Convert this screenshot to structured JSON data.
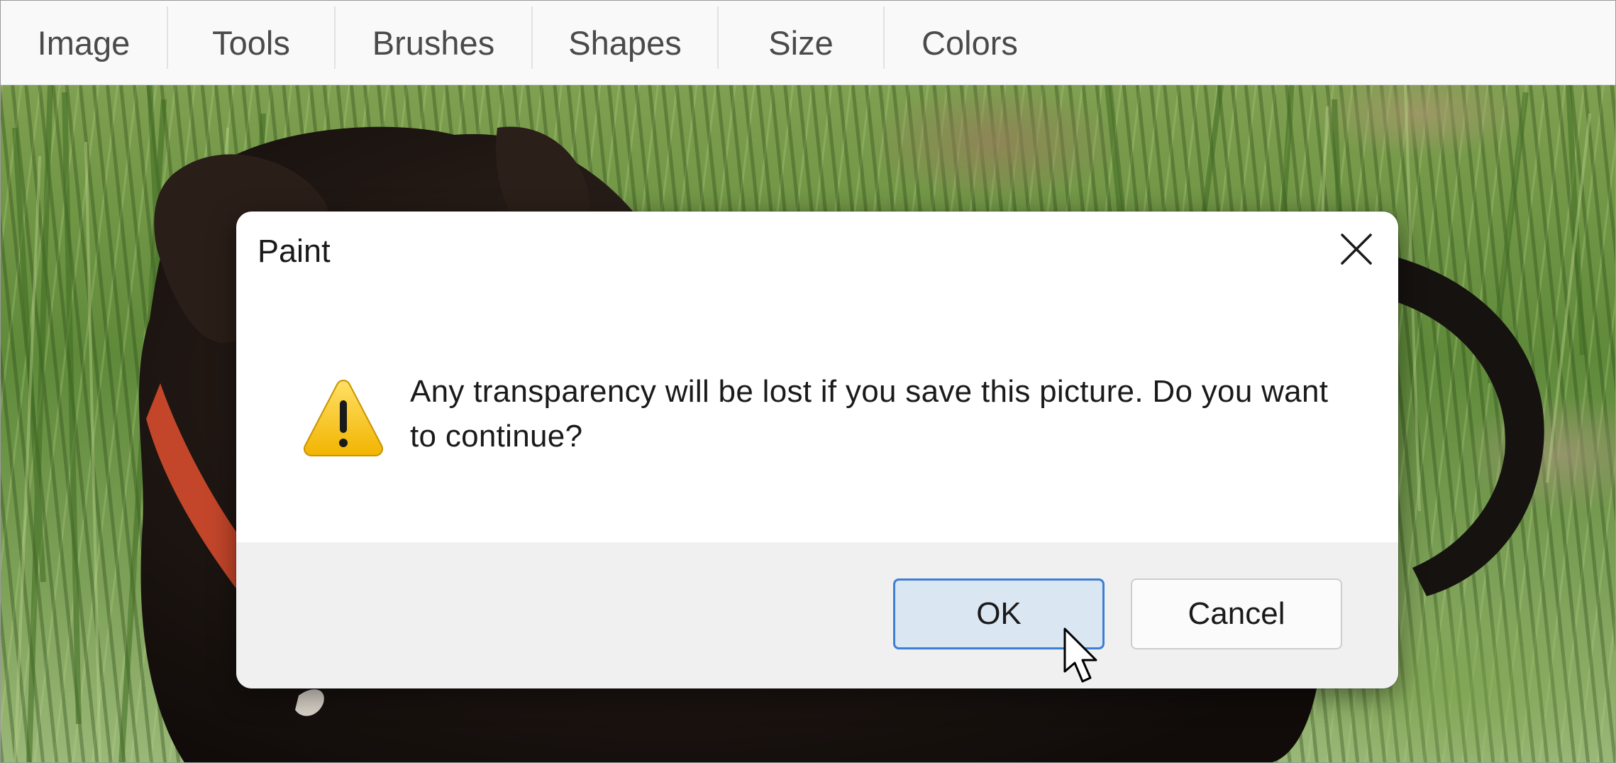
{
  "menu": {
    "items": [
      "Image",
      "Tools",
      "Brushes",
      "Shapes",
      "Size",
      "Colors"
    ]
  },
  "dialog": {
    "title": "Paint",
    "icon": "warning-icon",
    "message": "Any transparency will be lost if you save this picture. Do you want to continue?",
    "ok_label": "OK",
    "cancel_label": "Cancel",
    "close_icon": "close-icon"
  },
  "colors": {
    "accent": "#3d7fd4",
    "ok_fill": "#dbe6f3",
    "footer": "#f0f0f0",
    "warning": "#f4c20d"
  }
}
